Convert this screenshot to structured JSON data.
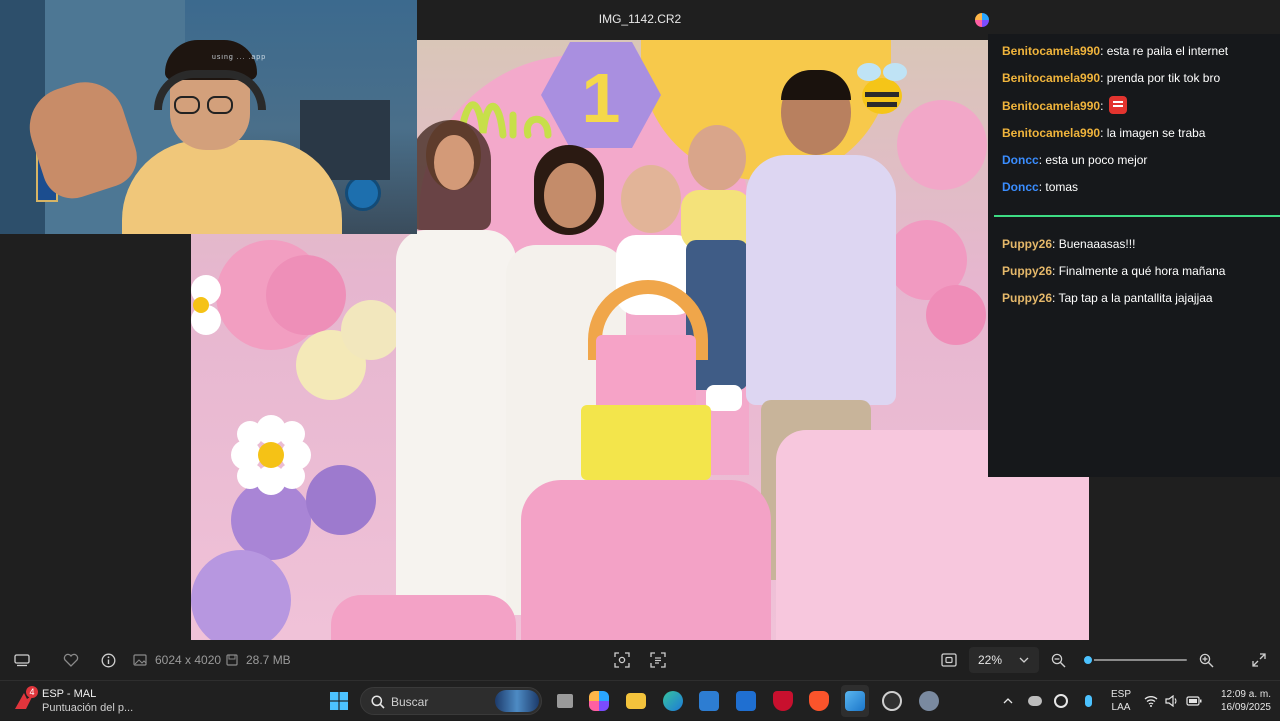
{
  "window": {
    "title": "IMG_1142.CR2"
  },
  "webcam": {
    "watermark": "using  ...  .app"
  },
  "chat": {
    "messages": [
      {
        "user": "Benitocamela990",
        "text": "esta re paila el internet",
        "color": "#f0b43c"
      },
      {
        "user": "Benitocamela990",
        "text": "prenda por tik tok bro",
        "color": "#f0b43c"
      },
      {
        "user": "Benitocamela990",
        "text": "",
        "emote": "angry-face-emote",
        "color": "#f0b43c"
      },
      {
        "user": "Benitocamela990",
        "text": "la imagen se traba",
        "color": "#f0b43c"
      },
      {
        "user": "Doncc",
        "text": "esta un poco mejor",
        "color": "#3a8dff"
      },
      {
        "user": "Doncc",
        "text": "tomas",
        "color": "#3a8dff"
      },
      {
        "user": "Puppy26",
        "text": "Buenaaasas!!!",
        "color": "#e5b86a"
      },
      {
        "user": "Puppy26",
        "text": "Finalmente a qué hora mañana",
        "color": "#e5b86a"
      },
      {
        "user": "Puppy26",
        "text": "Tap tap a la pantallita jajajjaa",
        "color": "#e5b86a"
      }
    ],
    "divider_color": "#3ddc84"
  },
  "toolbar": {
    "dimensions": "6024 x 4020",
    "file_size": "28.7 MB",
    "zoom_level": "22%",
    "zoom_fraction": 0.05,
    "accent": "#4cc2ff"
  },
  "taskbar": {
    "notification": {
      "badge": "4",
      "title": "ESP - MAL",
      "subtitle": "Puntuación del p..."
    },
    "search_placeholder": "Buscar",
    "language": {
      "line1": "ESP",
      "line2": "LAA"
    },
    "clock": {
      "time": "12:09 a. m.",
      "date": "16/09/2025"
    }
  }
}
